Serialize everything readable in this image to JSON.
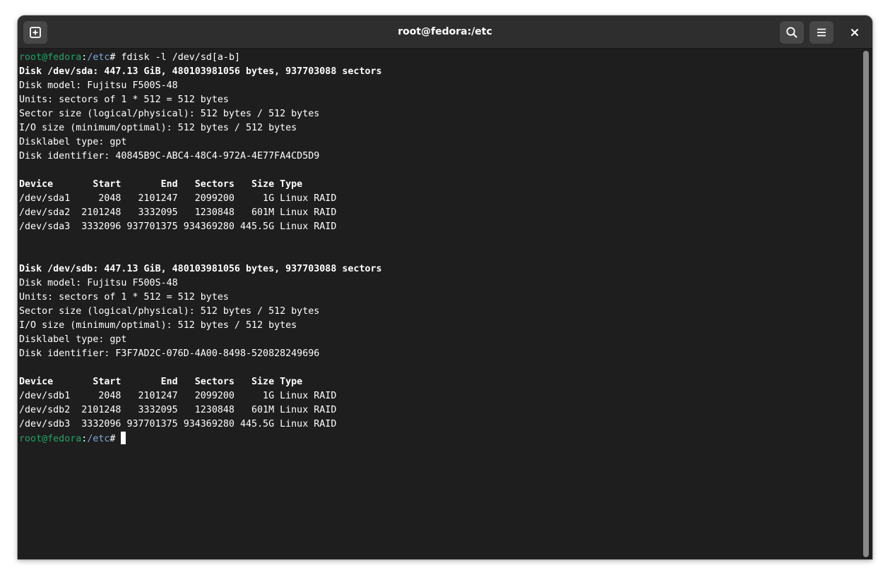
{
  "window": {
    "title": "root@fedora:/etc"
  },
  "icons": {
    "new_tab": "new-tab-icon",
    "search": "search-icon",
    "menu": "hamburger-menu-icon",
    "close": "close-icon"
  },
  "colors": {
    "background": "#1e1e1e",
    "titlebar": "#2e2e2e",
    "text": "#ffffff",
    "prompt_user": "#26a269",
    "prompt_path": "#7fa8d6"
  },
  "terminal": {
    "prompt_user": "root@fedora",
    "prompt_sep": ":",
    "prompt_path": "/etc",
    "prompt_char": "# ",
    "command": "fdisk -l /dev/sd[a-b]",
    "lines": [
      {
        "text": "Disk /dev/sda: 447.13 GiB, 480103981056 bytes, 937703088 sectors",
        "bold": true
      },
      {
        "text": "Disk model: Fujitsu F500S-48",
        "bold": false
      },
      {
        "text": "Units: sectors of 1 * 512 = 512 bytes",
        "bold": false
      },
      {
        "text": "Sector size (logical/physical): 512 bytes / 512 bytes",
        "bold": false
      },
      {
        "text": "I/O size (minimum/optimal): 512 bytes / 512 bytes",
        "bold": false
      },
      {
        "text": "Disklabel type: gpt",
        "bold": false
      },
      {
        "text": "Disk identifier: 40845B9C-ABC4-48C4-972A-4E77FA4CD5D9",
        "bold": false
      },
      {
        "text": "",
        "bold": false
      },
      {
        "text": "Device       Start       End   Sectors   Size Type",
        "bold": true
      },
      {
        "text": "/dev/sda1     2048   2101247   2099200     1G Linux RAID",
        "bold": false
      },
      {
        "text": "/dev/sda2  2101248   3332095   1230848   601M Linux RAID",
        "bold": false
      },
      {
        "text": "/dev/sda3  3332096 937701375 934369280 445.5G Linux RAID",
        "bold": false
      },
      {
        "text": "",
        "bold": false
      },
      {
        "text": "",
        "bold": false
      },
      {
        "text": "Disk /dev/sdb: 447.13 GiB, 480103981056 bytes, 937703088 sectors",
        "bold": true
      },
      {
        "text": "Disk model: Fujitsu F500S-48",
        "bold": false
      },
      {
        "text": "Units: sectors of 1 * 512 = 512 bytes",
        "bold": false
      },
      {
        "text": "Sector size (logical/physical): 512 bytes / 512 bytes",
        "bold": false
      },
      {
        "text": "I/O size (minimum/optimal): 512 bytes / 512 bytes",
        "bold": false
      },
      {
        "text": "Disklabel type: gpt",
        "bold": false
      },
      {
        "text": "Disk identifier: F3F7AD2C-076D-4A00-8498-520828249696",
        "bold": false
      },
      {
        "text": "",
        "bold": false
      },
      {
        "text": "Device       Start       End   Sectors   Size Type",
        "bold": true
      },
      {
        "text": "/dev/sdb1     2048   2101247   2099200     1G Linux RAID",
        "bold": false
      },
      {
        "text": "/dev/sdb2  2101248   3332095   1230848   601M Linux RAID",
        "bold": false
      },
      {
        "text": "/dev/sdb3  3332096 937701375 934369280 445.5G Linux RAID",
        "bold": false
      }
    ]
  }
}
